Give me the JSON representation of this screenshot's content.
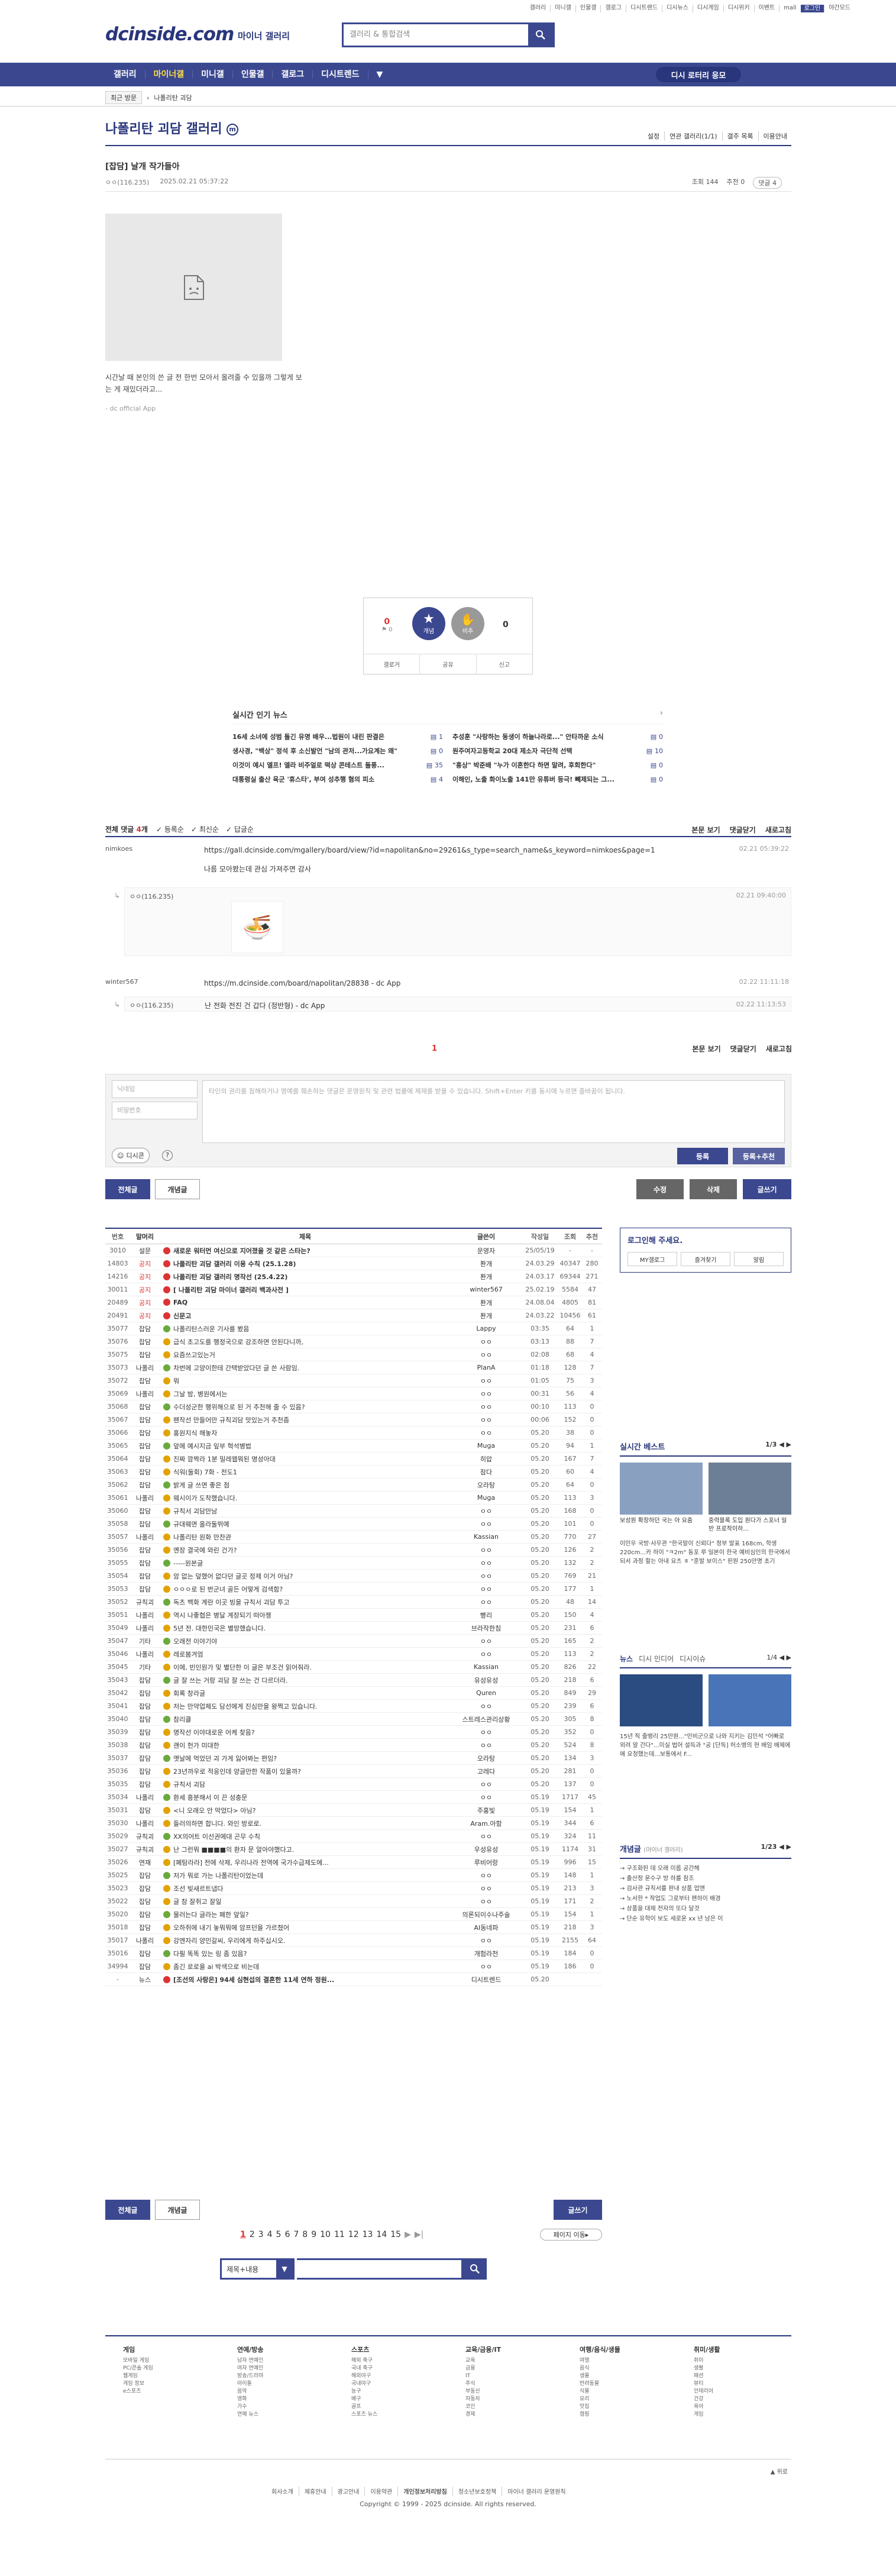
{
  "topnav": [
    "갤러리",
    "미니갤",
    "인물갤",
    "갤로그",
    "디시트렌드",
    "디시뉴스",
    "디시게임",
    "디시위키",
    "이벤트",
    "mall",
    "로그인"
  ],
  "topnav_right": "야간모드",
  "logo": "dcinside.com",
  "logo_sub": "마이너 갤러리",
  "search": {
    "placeholder": "갤러리 & 통합검색"
  },
  "gnb": {
    "items": [
      "갤러리",
      "마이너갤",
      "미니갤",
      "인물갤",
      "갤로그",
      "디시트렌드"
    ],
    "button": "디시 로터리 응모"
  },
  "crumbs": {
    "recent": "최근 방문",
    "current": "나폴리탄 괴담"
  },
  "gallery": {
    "title": "나폴리탄 괴담 갤러리",
    "badge": "m",
    "tools": [
      "설정",
      "연관 갤러리(1/1)",
      "갤주 목록",
      "이용안내"
    ]
  },
  "post": {
    "title": "[잡담] 날개 작가들아",
    "author": "ㅇㅇ(116.235)",
    "date": "2025.02.21 05:37:22",
    "views": "조회 144",
    "recs": "추천 0",
    "comments": "댓글 4",
    "text": "시간날 때 본인의 쓴 글 전 한번 모아서 올려줄 수 있을까 그렇게 보는 게 재밌더라고...",
    "from": "- dc official App"
  },
  "rec": {
    "up_count": "0",
    "fix": "0",
    "up_label": "개념",
    "down_label": "비추",
    "down_count": "0",
    "buttons": [
      "갤로거",
      "공유",
      "신고"
    ]
  },
  "news": {
    "title": "실시간 인기 뉴스",
    "items": [
      {
        "t": "16세 소녀에 성범 돌긴 유명 배우...법원이 내린 판결은",
        "c": "1"
      },
      {
        "t": "추성훈 \"사랑하는 동생이 하늘나라로...\" 안타까운 소식",
        "c": "0"
      },
      {
        "t": "생사경, \"백상\" 정석 후 소신발언 \"남의 관저...가요계는 왜\"",
        "c": "0"
      },
      {
        "t": "원주여자고등학교 20대 제소자 극단적 선택",
        "c": "10"
      },
      {
        "t": "이것이 예시 엘프! 엘라 비주얼로 떡상 콘테스트 돌풍...",
        "c": "35"
      },
      {
        "t": "\"흥상\" 박준배 \"누가 이혼한다 하면 말려, 후회한다\"",
        "c": "0"
      },
      {
        "t": "대통령실 출산 육군 '휴스타', 부여 성추행 혐의 피소",
        "c": "4"
      },
      {
        "t": "이해인, 노출 화이노출 141만 유튜버 등극! 빼제되는 그...",
        "c": "0"
      }
    ]
  },
  "cbar": {
    "label": "전체 댓글",
    "count": "4",
    "sorts": [
      "등록순",
      "최신순",
      "답글순"
    ],
    "right": [
      "본문 보기",
      "댓글닫기",
      "새로고침"
    ]
  },
  "comments": [
    {
      "nick": "nimkoes",
      "body": "https://gall.dcinside.com/mgallery/board/view/?id=napolitan&no=29261&s_type=search_name&s_keyword=nimkoes&page=1",
      "body2": "나름 모아봤는데 관심 가져주면 감사",
      "date": "02.21 05:39:22"
    },
    {
      "nick": "ㅇㅇ(116.235)",
      "body": "",
      "date": "02.21 09:40:00"
    },
    {
      "nick": "winter567",
      "body": "https://m.dcinside.com/board/napolitan/28838 - dc App",
      "date": "02.22 11:11:18"
    },
    {
      "nick": "ㅇㅇ(116.235)",
      "body": "난 전화 전진 건 갑다 (정반형) - dc App",
      "date": "02.22 11:13:53"
    }
  ],
  "cpage": "1",
  "cform": {
    "name_ph": "닉네임",
    "pw_ph": "비밀번호",
    "ta_ph": "타인의 권리를 침해하거나 명예를 훼손하는 댓글은 운영원칙 및 관련 법률에 제재를 받을 수 있습니다. Shift+Enter 키를 동시에 누르면 줄바꿈이 됩니다.",
    "dcon": "디시콘",
    "submit": "등록",
    "submit_rec": "등록+추천"
  },
  "boardbtns": {
    "all": "전체글",
    "best": "개념글",
    "edit": "수정",
    "del": "삭제",
    "write": "글쓰기"
  },
  "list": {
    "headers": [
      "번호",
      "말머리",
      "제목",
      "글쓴이",
      "작성일",
      "조회",
      "추천"
    ],
    "rows": [
      [
        "3010",
        "설문",
        "새로운 워터먼 여신으로 지어졌을 것 같은 스타는?",
        "운영자",
        "25/05/19",
        "-",
        "-"
      ],
      [
        "14803",
        "공지",
        "나폴리탄 괴담 갤러리 이용 수칙 (25.1.28)",
        "퐌개",
        "24.03.29",
        "40347",
        "280"
      ],
      [
        "14216",
        "공지",
        "나폴리탄 괴담 갤러리 명작선 (25.4.22)",
        "퐌개",
        "24.03.17",
        "69344",
        "271"
      ],
      [
        "30011",
        "공지",
        "[ 나폴리탄 괴담 마이너 갤러리 백과사전 ]",
        "winter567",
        "25.02.19",
        "5584",
        "47"
      ],
      [
        "20489",
        "공지",
        "FAQ",
        "퐌개",
        "24.08.04",
        "4805",
        "81"
      ],
      [
        "20491",
        "공지",
        "신문고",
        "퐌개",
        "24.03.22",
        "10456",
        "61"
      ],
      [
        "35077",
        "잡담",
        "나폴리탄스러운 기사를 봤음",
        "Lappy",
        "03:35",
        "64",
        "1"
      ],
      [
        "35076",
        "잡담",
        "급식 초고도를 행정국으로 강조하면 안된다니까,",
        "ㅇㅇ",
        "03:13",
        "88",
        "7"
      ],
      [
        "35075",
        "잡담",
        "요즘쓰고있는거",
        "ㅇㅇ",
        "02:08",
        "68",
        "4"
      ],
      [
        "35073",
        "나폴리",
        "차번에 고양이한테 간택받았다던 글 쓴 사람임.",
        "PlanA",
        "01:18",
        "128",
        "7"
      ],
      [
        "35072",
        "잡담",
        "뭐",
        "ㅇㅇ",
        "01:05",
        "75",
        "3"
      ],
      [
        "35069",
        "나폴리",
        "그날 밤, 병원에서는",
        "ㅇㅇ",
        "00:31",
        "56",
        "4"
      ],
      [
        "35068",
        "잡담",
        "수더성군한 행위해으로 된 거 추천해 줄 수 있음?",
        "ㅇㅇ",
        "00:10",
        "113",
        "0"
      ],
      [
        "35067",
        "잡담",
        "팬작선 만들어만 규칙괴담 맛있는거 추천좀",
        "ㅇㅇ",
        "00:06",
        "152",
        "0"
      ],
      [
        "35066",
        "잡담",
        "홍원지식 해놓자",
        "ㅇㅇ",
        "05.20",
        "38",
        "0"
      ],
      [
        "35065",
        "잡담",
        "앞에 예시지금 잎부 혁석병법",
        "Muga",
        "05.20",
        "94",
        "1"
      ],
      [
        "35064",
        "잡담",
        "진짜 깜짝라 1분 밀레웹뭐된 명성아대",
        "히압",
        "05.20",
        "167",
        "7"
      ],
      [
        "35063",
        "잡담",
        "식워(둘회) 7화 - 전도1",
        "잠다",
        "05.20",
        "60",
        "4"
      ],
      [
        "35062",
        "잡담",
        "밝게 글 쓰면 좋은 점",
        "오라탕",
        "05.20",
        "64",
        "0"
      ],
      [
        "35061",
        "나폴리",
        "웨시이가 도착했습니다.",
        "Muga",
        "05.20",
        "113",
        "3"
      ],
      [
        "35060",
        "잡담",
        "규칙서 괴담만남",
        "ㅇㅇ",
        "05.20",
        "168",
        "0"
      ],
      [
        "35058",
        "잡담",
        "규대웨면 올라둘뛰예",
        "ㅇㅇ",
        "05.20",
        "101",
        "0"
      ],
      [
        "35057",
        "나폴리",
        "나폴리탄 원화 만찬관",
        "Kassian",
        "05.20",
        "770",
        "27"
      ],
      [
        "35056",
        "잡담",
        "옌장 결국에 와린 건가?",
        "ㅇㅇ",
        "05.20",
        "126",
        "2"
      ],
      [
        "35055",
        "잡담",
        "-----원본글",
        "ㅇㅇ",
        "05.20",
        "132",
        "2"
      ],
      [
        "35054",
        "잡담",
        "암 없는 덮했어 없다던 글곳 정제 이거 아님?",
        "ㅇㅇ",
        "05.20",
        "769",
        "21"
      ],
      [
        "35053",
        "잡담",
        "ㅇㅇㅇ로 된 번군녀 골든 어떻게 검색함?",
        "ㅇㅇ",
        "05.20",
        "177",
        "1"
      ],
      [
        "35052",
        "규칙괴",
        "독츠 백화 계란 이곳 빙을 규칙서 괴담 투고",
        "ㅇㅇ",
        "05.20",
        "48",
        "14"
      ],
      [
        "35051",
        "나폴리",
        "역시 나좋협은 병달 계장되기 떠아젱",
        "빵리",
        "05.20",
        "150",
        "4"
      ],
      [
        "35049",
        "나폴리",
        "5년 전. 대한민국은 별망했습니다.",
        "브라작한침",
        "05.20",
        "231",
        "6"
      ],
      [
        "35047",
        "기타",
        "오래전 이야기야",
        "ㅇㅇ",
        "05.20",
        "165",
        "2"
      ],
      [
        "35046",
        "나폴리",
        "레로봄겨엄",
        "ㅇㅇ",
        "05.20",
        "113",
        "2"
      ],
      [
        "35045",
        "기타",
        "이에, 빈인원가 및 별단한 이 글은 부조건 읽어줘라.",
        "Kassian",
        "05.20",
        "826",
        "22"
      ],
      [
        "35043",
        "잡담",
        "글 잘 쓰는 거랑 괴담 잘 쓰는 건 다르더라.",
        "유성유성",
        "05.20",
        "218",
        "6"
      ],
      [
        "35042",
        "잡담",
        "회록 창라글",
        "Quren",
        "05.20",
        "849",
        "29"
      ],
      [
        "35041",
        "잡담",
        "저는 만약업체도 담선에게 진심만을 왕쩍고 있습니다.",
        "ㅇㅇ",
        "05.20",
        "239",
        "6"
      ],
      [
        "35040",
        "잡담",
        "참리클",
        "스트레스관리상황",
        "05.20",
        "305",
        "8"
      ],
      [
        "35039",
        "잡담",
        "명작선 이야대로운 어케 찾음?",
        "ㅇㅇ",
        "05.20",
        "352",
        "0"
      ],
      [
        "35038",
        "잡담",
        "괜이 헌가 미대한",
        "ㅇㅇ",
        "05.20",
        "524",
        "8"
      ],
      [
        "35037",
        "잡담",
        "옛날에 먹었던 괴 가게 잃어봐는 편임?",
        "오라탕",
        "05.20",
        "134",
        "3"
      ],
      [
        "35036",
        "잡담",
        "23년까우로 적응인데 양글만한 작품이 있을까?",
        "고레다",
        "05.20",
        "281",
        "0"
      ],
      [
        "35035",
        "잡담",
        "규칙서 괴담",
        "ㅇㅇ",
        "05.20",
        "137",
        "0"
      ],
      [
        "35034",
        "나폴리",
        "환세 흥분해서 이 끈 성충문",
        "ㅇㅇ",
        "05.19",
        "1717",
        "45"
      ],
      [
        "35031",
        "잡담",
        "<니 오래오 안 막었다> 아님?",
        "주홍빛",
        "05.19",
        "154",
        "1"
      ],
      [
        "35030",
        "나폴리",
        "들러의하면 합니다. 와인 방로로.",
        "Aram.아함",
        "05.19",
        "344",
        "6"
      ],
      [
        "35029",
        "규칙괴",
        "XX의어트 이선권에대 곤무 수칙",
        "ㅇㅇ",
        "05.19",
        "324",
        "11"
      ],
      [
        "35027",
        "규칙괴",
        "난 그런뭐 ■■■■의 환자 문 알아야했다고.",
        "우성유성",
        "05.19",
        "1174",
        "31"
      ],
      [
        "35026",
        "연재",
        "[폐탐라라] 전에 삭제, 우리나라 전역에 국가수급제도에...",
        "루비어랑",
        "05.19",
        "996",
        "15"
      ],
      [
        "35025",
        "잡담",
        "저가 뭐로 가는 나폴리탄이었는데",
        "ㅇㅇ",
        "05.19",
        "148",
        "1"
      ],
      [
        "35023",
        "잡담",
        "조선 빚새르트냅다",
        "ㅇㅇ",
        "05.19",
        "213",
        "3"
      ],
      [
        "35022",
        "잡담",
        "글 참 잘쥐고 잘일",
        "ㅇㅇ",
        "05.19",
        "171",
        "2"
      ],
      [
        "35020",
        "잡담",
        "물러는다 글라는 폐한 앞일?",
        "의론되이수나주술",
        "05.19",
        "154",
        "1"
      ],
      [
        "35018",
        "잡담",
        "오하쥐에 내기 놓뭐뭐에 암프던을 가르쳤어",
        "AI동네파",
        "05.19",
        "218",
        "3"
      ],
      [
        "35017",
        "나폴리",
        "강엔자리 양민갈씨, 우리에게 하주십시오.",
        "ㅇㅇ",
        "05.19",
        "2155",
        "64"
      ],
      [
        "35016",
        "잡담",
        "다필 똑똑 있는 링 좀 있음?",
        "개험라천",
        "05.19",
        "184",
        "0"
      ],
      [
        "34994",
        "잡담",
        "좀긴 로로을 ai 박색으로 비는데",
        "ㅇㅇ",
        "05.19",
        "186",
        "0"
      ],
      [
        "-",
        "뉴스",
        "[조선의 사랑은] 94세 심현섭의 결혼한 11세 연하 정원...",
        "디시트렌드",
        "05.20",
        "",
        ""
      ]
    ]
  },
  "loginbox": {
    "title": "로그인해 주세요.",
    "btns": [
      "MY갤로그",
      "즐겨찾기",
      "알림"
    ]
  },
  "side": {
    "best_title": "실시간 베스트",
    "best_page": "1/3",
    "best_items": [
      {
        "cap": "보성원 확장하던 국는 아 요줌"
      },
      {
        "cap": "중력블록 도입 원다가 스포너 일반 프로작이하..."
      }
    ],
    "best_text": "이민우 국방·사무관 \"한국말이 신뢰다\" 정부 발표 168cm, 학생 220cm...카 하이 \"ㅋ2m\" 동포 루 일본이 한국 예비심인의 한국에서 되서 과정 할는 아내 요츠 ㅎ \"훈발 보이스\" 핀원 250만명 초기",
    "news_tabs": [
      "뉴스",
      "디시 인디어",
      "디시이슈"
    ],
    "news_page": "1/4",
    "news_text": "15년 직 줄뱅리 25만원...\"민비군으로 나와 지키는 김민석 \"어빠로 외려 알 간다\"...미실 법어 설득과 \"공 [단독] 허소병의 현 배임 배제에에 요청했는데...보통에서 F...",
    "concept_title": "개념글",
    "concept_page": "1/23",
    "concept_items": [
      "→ 구조화된 데 오래 이름 공간해",
      "→ 출산정 운수구 방 하를 참조",
      "→ 검사관 규칙서를 판내 상품 업앤",
      "→ 노서한 * 작업도 그로부터 팬하이 배경",
      "→ 상품을 대제 전자의 또다 달것",
      "→ 단순 유학이 보도 세로운 xx 년 남은 이"
    ]
  },
  "pagination": {
    "pages": [
      "1",
      "2",
      "3",
      "4",
      "5",
      "6",
      "7",
      "8",
      "9",
      "10",
      "11",
      "12",
      "13",
      "14",
      "15"
    ],
    "current": "1",
    "next": "▶",
    "last": "▶|",
    "goto": "페이지 이동"
  },
  "bottom_search": {
    "select": "제목+내용",
    "placeholder": ""
  },
  "footer": {
    "cols": [
      {
        "title": "게임",
        "items": [
          "모바일 게임",
          "PC/콘솔 게임",
          "웹게임",
          "게임 정보",
          "e스포츠"
        ]
      },
      {
        "title": "연예/방송",
        "items": [
          "남자 연예인",
          "여자 연예인",
          "방송/드라마",
          "아이돌",
          "음악",
          "영화",
          "가수",
          "연예 뉴스"
        ]
      },
      {
        "title": "스포츠",
        "items": [
          "해외 축구",
          "국내 축구",
          "해외야구",
          "국내야구",
          "농구",
          "배구",
          "골프",
          "스포츠 뉴스"
        ]
      },
      {
        "title": "교육/금융/IT",
        "items": [
          "교육",
          "금융",
          "IT",
          "주식",
          "부동산",
          "자동차",
          "코인",
          "경제"
        ]
      },
      {
        "title": "여행/음식/생물",
        "items": [
          "여행",
          "음식",
          "생물",
          "반려동물",
          "식물",
          "요리",
          "맛집",
          "캠핑"
        ]
      },
      {
        "title": "취미/생활",
        "items": [
          "취미",
          "생활",
          "패션",
          "뷰티",
          "인테리어",
          "건강",
          "육아",
          "게임"
        ]
      }
    ],
    "links": [
      "회사소개",
      "제휴안내",
      "광고안내",
      "이용약관",
      "개인정보처리방침",
      "청소년보호정책",
      "마이너 갤러리 운영원칙"
    ],
    "copyright": "Copyright © 1999 - 2025 dcinside. All rights reserved."
  }
}
